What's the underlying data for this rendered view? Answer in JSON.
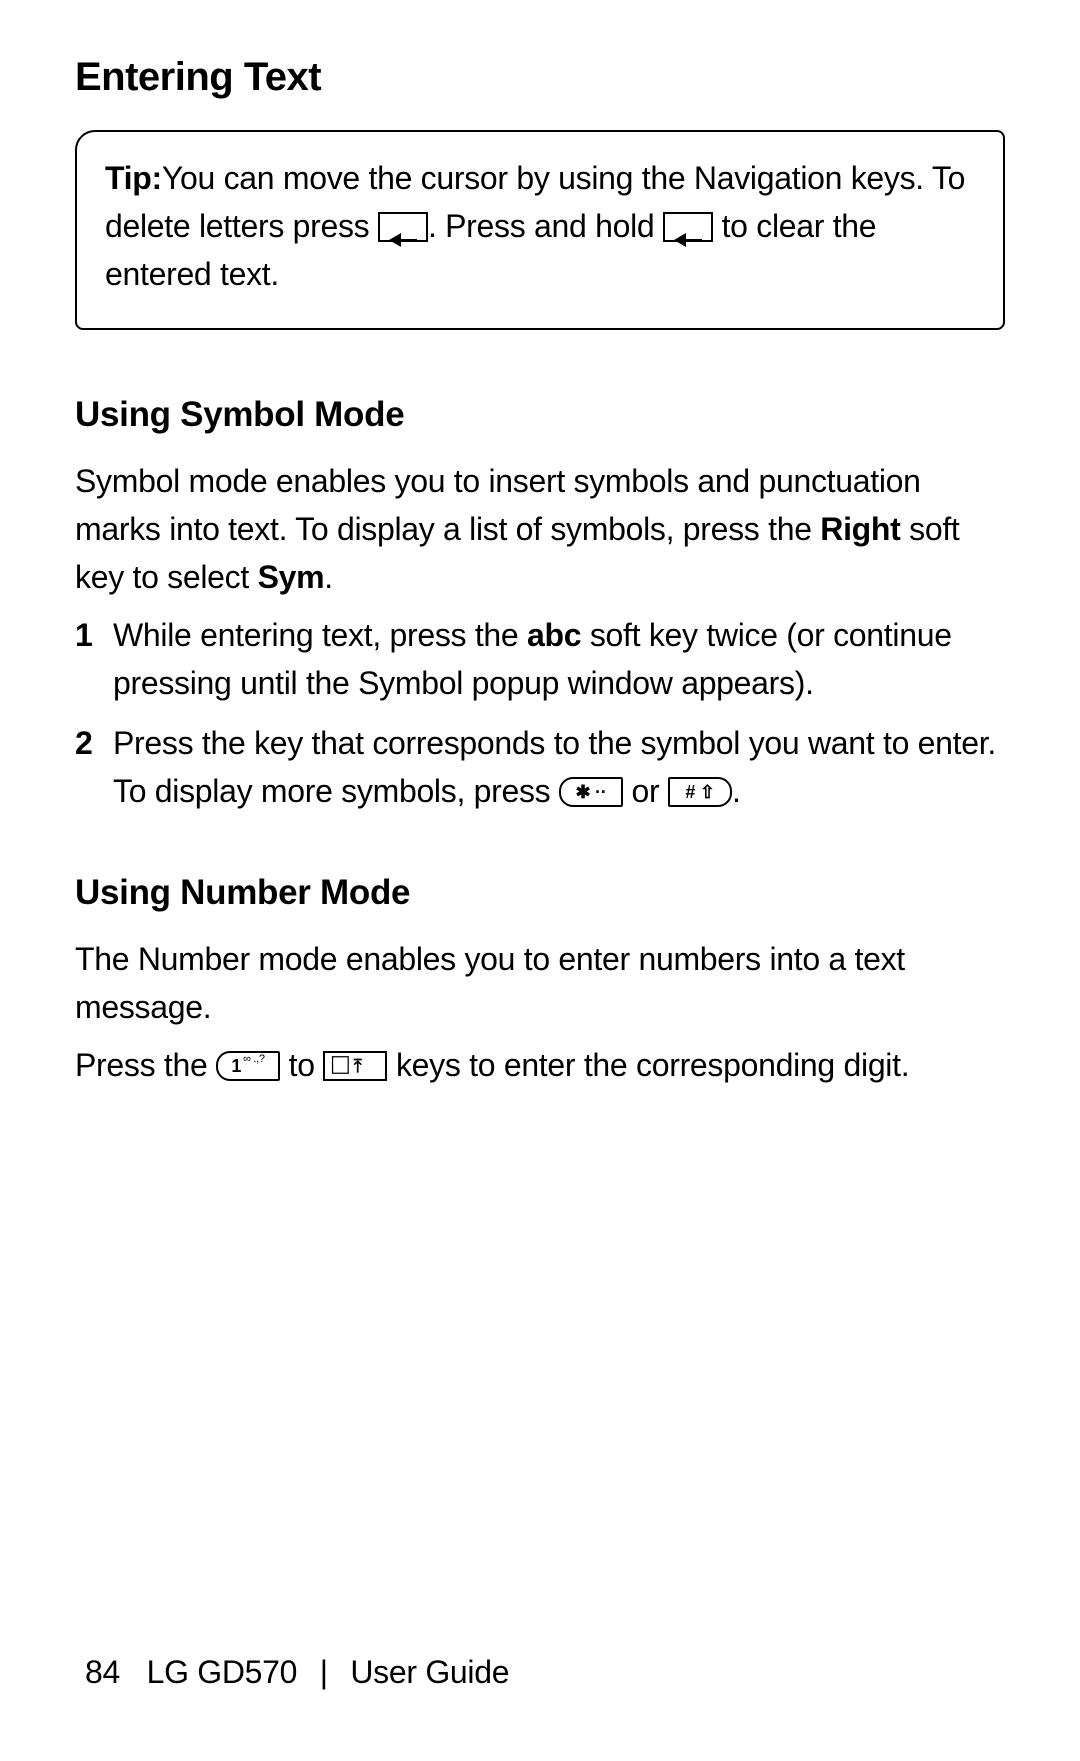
{
  "title": "Entering Text",
  "tip": {
    "label": "Tip:",
    "text_before_key1": "You can move the cursor by using the Navigation keys. To delete letters press ",
    "text_after_key1": ". Press and hold ",
    "text_after_key2": " to clear the entered text."
  },
  "section1": {
    "heading": "Using Symbol Mode",
    "intro_before_right": "Symbol mode enables you to insert symbols and punctuation marks into text. To display a list of symbols, press the ",
    "right_label": "Right",
    "intro_middle": " soft key to select ",
    "sym_label": "Sym",
    "intro_end": ".",
    "step1_num": "1",
    "step1_before_abc": "While entering text, press the ",
    "step1_abc": "abc",
    "step1_after_abc": " soft key twice (or continue pressing until the Symbol popup window appears).",
    "step2_num": "2",
    "step2_before_keys": "Press the key that corresponds to the symbol you want to enter. To display more symbols, press ",
    "step2_or": " or ",
    "step2_end": "."
  },
  "section2": {
    "heading": "Using Number Mode",
    "intro": "The Number mode enables you to enter numbers into a text message.",
    "press_before": "Press the ",
    "press_to": " to ",
    "press_after": " keys to enter the corresponding digit."
  },
  "keys": {
    "star": "✱ ··",
    "hash": "# ⇧",
    "one": "1",
    "one_sub": "∞\n.,?",
    "zero": "⃞ ⤒"
  },
  "footer": {
    "page_number": "84",
    "model": "LG GD570",
    "divider": "|",
    "guide": "User Guide"
  }
}
